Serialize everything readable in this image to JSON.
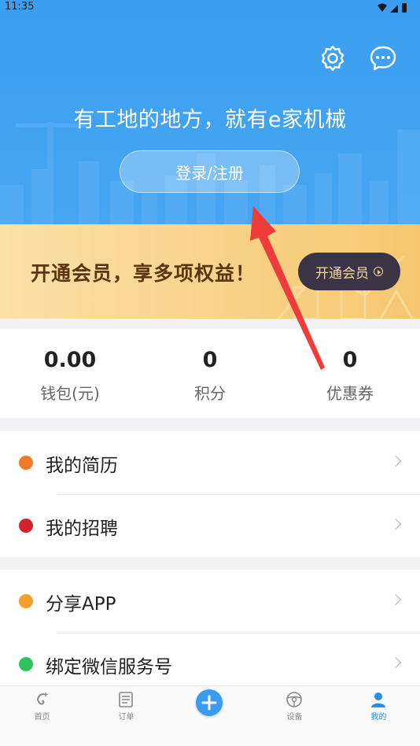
{
  "status_bar": {
    "time": "11:35"
  },
  "header": {
    "slogan": "有工地的地方，就有e家机械",
    "login_label": "登录/注册"
  },
  "member": {
    "promo_text": "开通会员，享多项权益！",
    "button_label": "开通会员"
  },
  "stats": [
    {
      "value": "0.00",
      "label": "钱包(元)"
    },
    {
      "value": "0",
      "label": "积分"
    },
    {
      "value": "0",
      "label": "优惠券"
    }
  ],
  "menu": {
    "group1": [
      {
        "label": "我的简历",
        "icon": "resume-icon"
      },
      {
        "label": "我的招聘",
        "icon": "recruit-icon"
      }
    ],
    "group2": [
      {
        "label": "分享APP",
        "icon": "share-icon"
      },
      {
        "label": "绑定微信服务号",
        "icon": "wechat-icon"
      }
    ]
  },
  "tabbar": [
    {
      "label": "首页"
    },
    {
      "label": "订单"
    },
    {
      "label": ""
    },
    {
      "label": "设备"
    },
    {
      "label": "我的"
    }
  ],
  "colors": {
    "header_blue": "#3b9ef0",
    "member_gold": "#f6c770",
    "button_dark": "#3a3445",
    "active_tab": "#2d8ee8",
    "arrow_red": "#ef3b3b"
  }
}
